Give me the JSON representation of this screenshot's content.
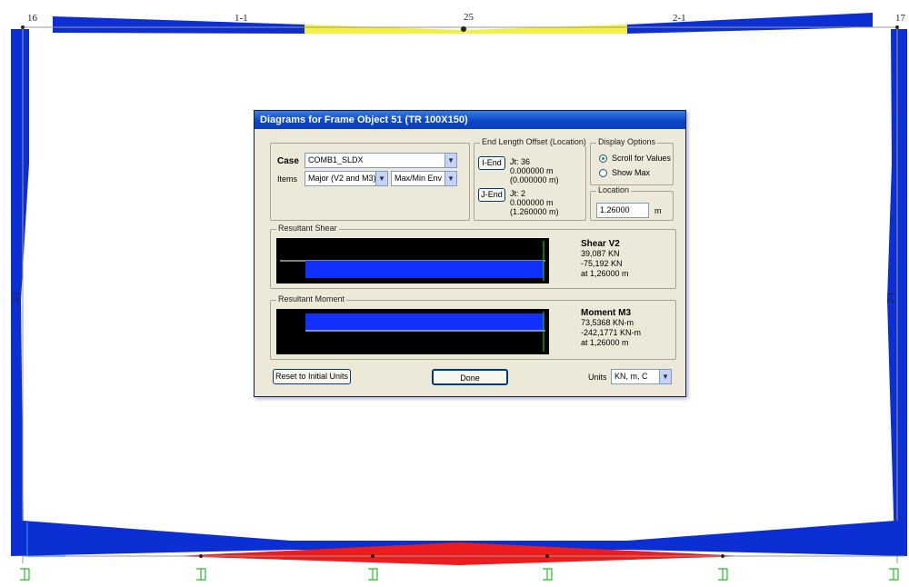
{
  "frame": {
    "node_labels": [
      "16",
      "1-1",
      "25",
      "2-1",
      "17"
    ],
    "left_label": "3-1",
    "right_label": "2-1",
    "colors": {
      "negative": "#0b2fd2",
      "positive_top": "#f6ef3c",
      "positive_bottom": "#ee1c1c",
      "support": "#22c422"
    }
  },
  "dialog": {
    "title": "Diagrams for Frame Object 51  (TR 100X150)",
    "case_label": "Case",
    "case_value": "COMB1_SLDX",
    "items_label": "Items",
    "items_value": "Major (V2 and M3)",
    "envelope_value": "Max/Min Env",
    "end_offset": {
      "legend": "End Length Offset (Location)",
      "i_end_button": "I-End",
      "i_joint": "Jt: 36",
      "i_offset": "0.000000 m",
      "i_location": "(0.000000 m)",
      "j_end_button": "J-End",
      "j_joint": "Jt: 2",
      "j_offset": "0.000000 m",
      "j_location": "(1.260000 m)"
    },
    "display_options": {
      "legend": "Display Options",
      "scroll_option": "Scroll for Values",
      "show_max_option": "Show Max",
      "selected": "scroll"
    },
    "location": {
      "legend": "Location",
      "value": "1.26000",
      "unit": "m"
    },
    "shear": {
      "legend": "Resultant Shear",
      "title": "Shear V2",
      "line1": "39,087 KN",
      "line2": "-75,192 KN",
      "line3": "at 1,26000 m"
    },
    "moment": {
      "legend": "Resultant Moment",
      "title": "Moment M3",
      "line1": "73,5368 KN-m",
      "line2": "-242,1771 KN-m",
      "line3": "at 1,26000 m"
    },
    "reset_button": "Reset to Initial Units",
    "done_button": "Done",
    "units_label": "Units",
    "units_value": "KN, m, C"
  }
}
